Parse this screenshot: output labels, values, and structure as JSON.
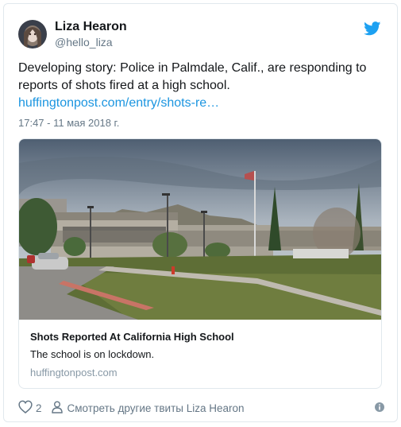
{
  "author": {
    "name": "Liza Hearon",
    "handle": "@hello_liza"
  },
  "tweet": {
    "text": "Developing story: Police in Palmdale, Calif., are responding to reports of shots fired at a high school.",
    "link": "huffingtonpost.com/entry/shots-re…",
    "timestamp": "17:47 - 11 мая 2018 г."
  },
  "card": {
    "title": "Shots Reported At California High School",
    "description": "The school is on lockdown.",
    "domain": "huffingtonpost.com"
  },
  "footer": {
    "like_count": "2",
    "more_tweets": "Смотреть другие твиты Liza Hearon"
  },
  "colors": {
    "link": "#1b95e0",
    "brand": "#1da1f2",
    "muted": "#657786"
  },
  "icons": [
    "twitter-bird-icon",
    "heart-icon",
    "person-icon",
    "info-icon"
  ]
}
